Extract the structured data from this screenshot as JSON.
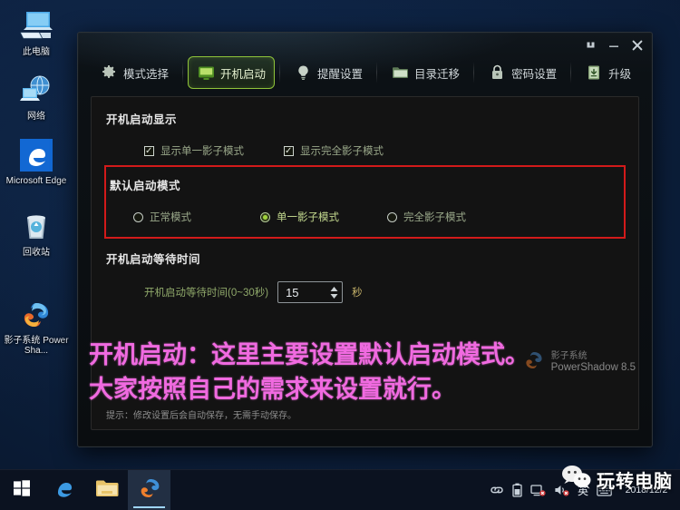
{
  "desktop": {
    "icons": [
      {
        "label": "此电脑",
        "icon": "this-pc-icon"
      },
      {
        "label": "网络",
        "icon": "network-icon"
      },
      {
        "label": "Microsoft Edge",
        "icon": "edge-icon"
      },
      {
        "label": "回收站",
        "icon": "recycle-bin-icon"
      },
      {
        "label": "影子系统 PowerSha...",
        "icon": "powershadow-icon"
      }
    ]
  },
  "window": {
    "controls": {
      "pin": "pin-icon",
      "minimize": "minimize-icon",
      "close": "close-icon"
    },
    "tabs": [
      {
        "label": "模式选择",
        "icon": "gear-icon",
        "active": false
      },
      {
        "label": "开机启动",
        "icon": "monitor-icon",
        "active": true
      },
      {
        "label": "提醒设置",
        "icon": "bulb-icon",
        "active": false
      },
      {
        "label": "目录迁移",
        "icon": "folder-icon",
        "active": false
      },
      {
        "label": "密码设置",
        "icon": "lock-icon",
        "active": false
      },
      {
        "label": "升级",
        "icon": "download-icon",
        "active": false
      }
    ],
    "sections": {
      "display": {
        "title": "开机启动显示",
        "checkboxes": [
          {
            "label": "显示单一影子模式",
            "checked": true,
            "mark": "✓"
          },
          {
            "label": "显示完全影子模式",
            "checked": true,
            "mark": "✓"
          }
        ]
      },
      "default_mode": {
        "title": "默认启动模式",
        "highlight_color": "#d21a1a",
        "options": [
          {
            "label": "正常模式",
            "selected": false
          },
          {
            "label": "单一影子模式",
            "selected": true
          },
          {
            "label": "完全影子模式",
            "selected": false
          }
        ]
      },
      "wait_time": {
        "title": "开机启动等待时间",
        "field_label": "开机启动等待时间(0~30秒)",
        "value": "15",
        "unit": "秒"
      }
    },
    "hint": "提示：修改设置后会自动保存，无需手动保存。",
    "watermark": {
      "cn": "影子系统",
      "en": "PowerShadow",
      "version": "8.5"
    }
  },
  "annotation": {
    "line1": "开机启动：这里主要设置默认启动模式。",
    "line2": "大家按照自己的需求来设置就行。",
    "color": "#f06ae0"
  },
  "taskbar": {
    "start": "windows-start-icon",
    "items": [
      {
        "icon": "edge-icon",
        "active": false
      },
      {
        "icon": "file-explorer-icon",
        "active": false
      },
      {
        "icon": "powershadow-icon",
        "active": true
      }
    ],
    "tray": [
      {
        "icon": "link-icon"
      },
      {
        "icon": "battery-icon"
      },
      {
        "icon": "network-tray-icon"
      },
      {
        "icon": "volume-icon"
      },
      {
        "icon": "ime-chinese-icon",
        "label": "英"
      },
      {
        "icon": "ime-keyboard-icon"
      }
    ],
    "clock": {
      "date": "2018/12/2"
    },
    "overlay": {
      "label": "玩转电脑",
      "icon": "wechat-icon"
    }
  }
}
